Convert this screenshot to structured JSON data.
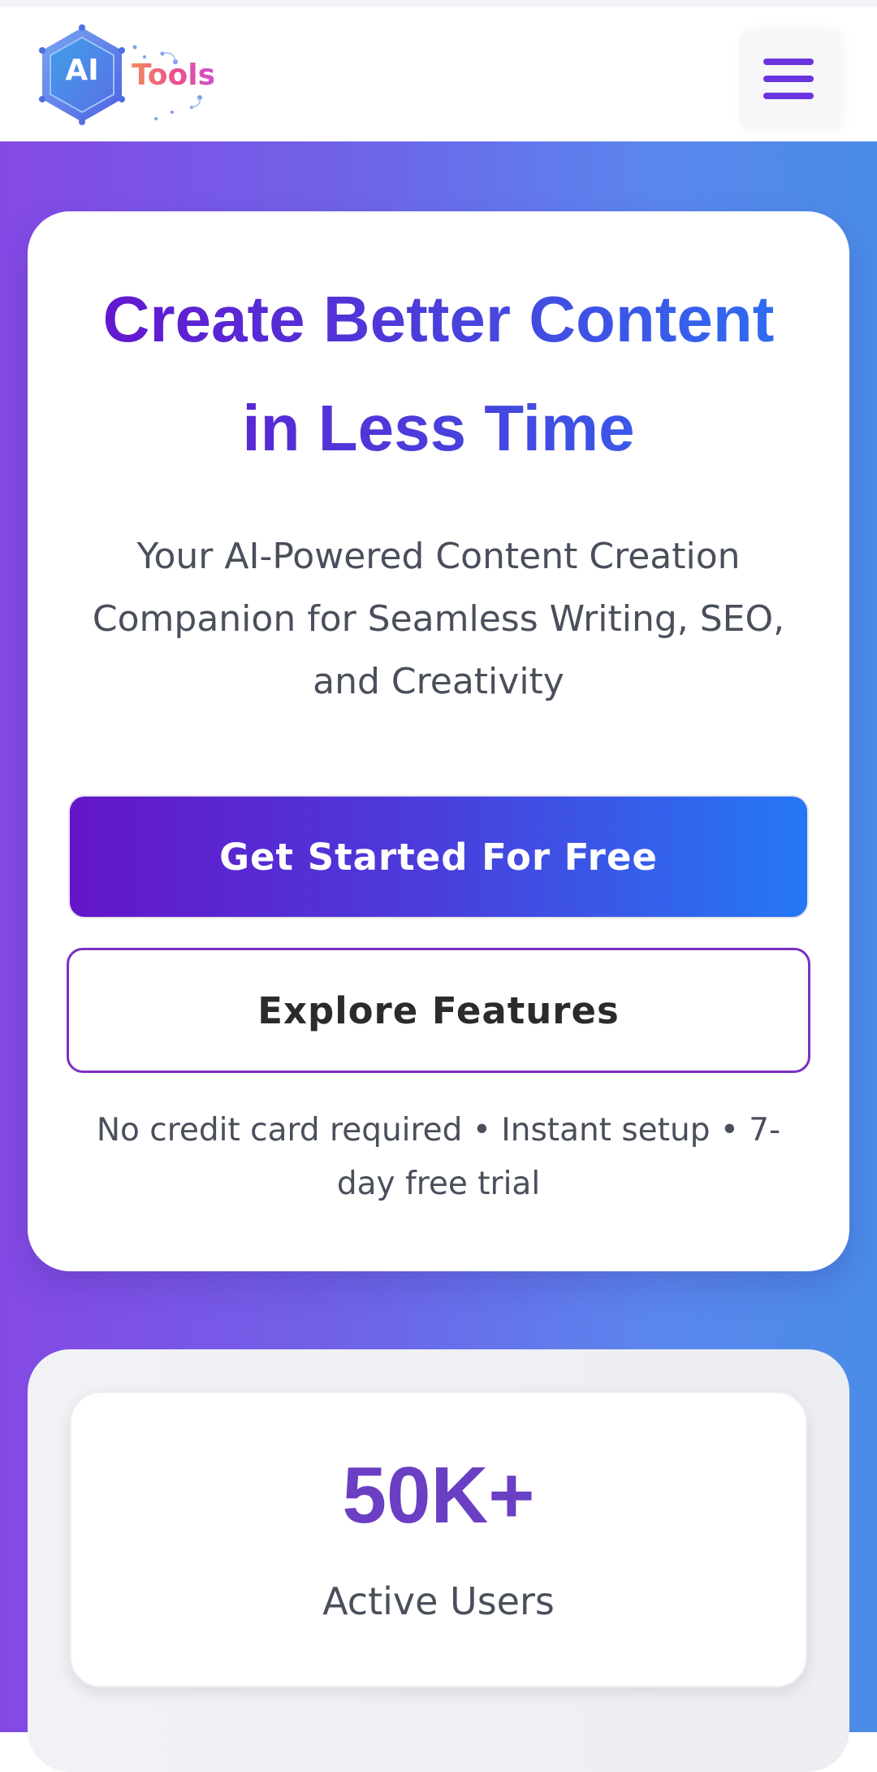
{
  "header": {
    "logo": {
      "badge_text": "AI",
      "wordmark": "Tools",
      "icon": "hexagon-logo-icon"
    },
    "menu_icon": "hamburger-menu-icon"
  },
  "hero": {
    "title": "Create Better Content in Less Time",
    "subtitle": "Your AI-Powered Content Creation Companion for Seamless Writing, SEO, and Creativity",
    "primary_button": "Get Started For Free",
    "secondary_button": "Explore Features",
    "note": "No credit card required • Instant setup • 7-day free trial"
  },
  "stats": [
    {
      "value": "50K+",
      "label": "Active Users"
    }
  ],
  "colors": {
    "accent_purple": "#6614cf",
    "accent_blue": "#2478f6",
    "stat_value": "#6a3fc3",
    "outline_button_border": "#7b30c2"
  }
}
